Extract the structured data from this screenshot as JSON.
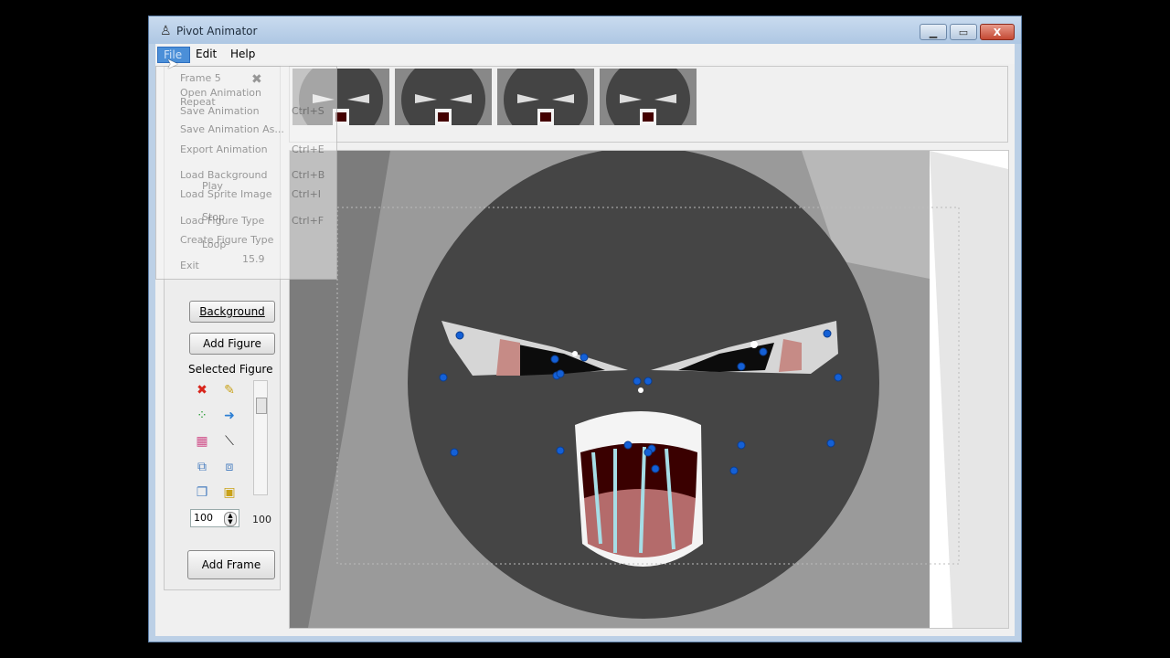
{
  "window": {
    "title": "Pivot Animator",
    "min_glyph": "▁",
    "max_glyph": "▭",
    "close_glyph": "X"
  },
  "menu": {
    "file": "File",
    "edit": "Edit",
    "help": "Help"
  },
  "panel": {
    "background_button": "Background",
    "add_figure_button": "Add Figure",
    "selected_figure_label": "Selected Figure",
    "spin_value": "100",
    "spin_readout": "100",
    "add_frame_button": "Add Frame"
  },
  "ghost_menu": {
    "frame_label": "Frame 5",
    "repeat_label": "Repeat",
    "items": [
      {
        "label": "Open Animation",
        "shortcut": ""
      },
      {
        "label": "Save Animation",
        "shortcut": "Ctrl+S"
      },
      {
        "label": "Save Animation As...",
        "shortcut": ""
      },
      {
        "label": "Export Animation",
        "shortcut": "Ctrl+E"
      },
      {
        "label": "Load Background",
        "shortcut": "Ctrl+B"
      },
      {
        "label": "Load Sprite Image",
        "shortcut": "Ctrl+I"
      },
      {
        "label": "Load Figure Type",
        "shortcut": "Ctrl+F"
      },
      {
        "label": "Create Figure Type",
        "shortcut": ""
      },
      {
        "label": "Exit",
        "shortcut": ""
      }
    ],
    "play": "Play",
    "stop": "Stop",
    "loop": "Loop",
    "fps": "15.9"
  },
  "icons": {
    "delete": "red-cross-icon",
    "edit": "pencil-icon",
    "center": "center-icon",
    "flip": "flip-arrow-icon",
    "color": "color-icon",
    "line": "line-icon",
    "front": "bring-front-icon",
    "back": "send-back-icon",
    "copy": "copy-icon",
    "paste": "paste-icon"
  },
  "colors": {
    "accent": "#4b8fd8",
    "face": "#444444",
    "joint": "#1460d6",
    "delete": "#d8251b"
  }
}
